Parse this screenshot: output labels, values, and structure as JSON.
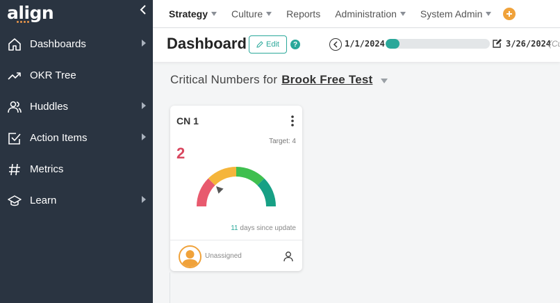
{
  "app": {
    "brand": "align",
    "colors": {
      "accent": "#2aa89a",
      "sidebar": "#2a3441",
      "brand_dot": "#e8954a",
      "value_red": "#d9475f",
      "add": "#f0a23a"
    }
  },
  "sidebar": {
    "items": [
      {
        "label": "Dashboards",
        "icon": "home-icon",
        "has_submenu": true
      },
      {
        "label": "OKR Tree",
        "icon": "trend-up-icon",
        "has_submenu": false
      },
      {
        "label": "Huddles",
        "icon": "users-icon",
        "has_submenu": true
      },
      {
        "label": "Action Items",
        "icon": "checkbox-icon",
        "has_submenu": true
      },
      {
        "label": "Metrics",
        "icon": "hash-icon",
        "has_submenu": false
      },
      {
        "label": "Learn",
        "icon": "graduation-cap-icon",
        "has_submenu": true
      }
    ]
  },
  "topnav": {
    "items": [
      {
        "label": "Strategy",
        "active": true,
        "dropdown": true
      },
      {
        "label": "Culture",
        "active": false,
        "dropdown": true
      },
      {
        "label": "Reports",
        "active": false,
        "dropdown": false
      },
      {
        "label": "Administration",
        "active": false,
        "dropdown": true
      },
      {
        "label": "System Admin",
        "active": false,
        "dropdown": true
      }
    ]
  },
  "header": {
    "title": "Dashboard",
    "edit_label": "Edit",
    "help": "?",
    "start_date": "1/1/2024",
    "end_date": "3/26/2024",
    "end_date_note": "(Cu",
    "progress_percent": 13
  },
  "content": {
    "section_prefix": "Critical Numbers for",
    "team_name": "Brook Free Test"
  },
  "card": {
    "title": "CN 1",
    "target": "Target: 4",
    "value": "2",
    "days": "11",
    "days_suffix": " days since update",
    "owner": "Unassigned",
    "gauge_colors": [
      "#e85a6e",
      "#f5b53b",
      "#3fbf4f",
      "#17a085"
    ]
  }
}
